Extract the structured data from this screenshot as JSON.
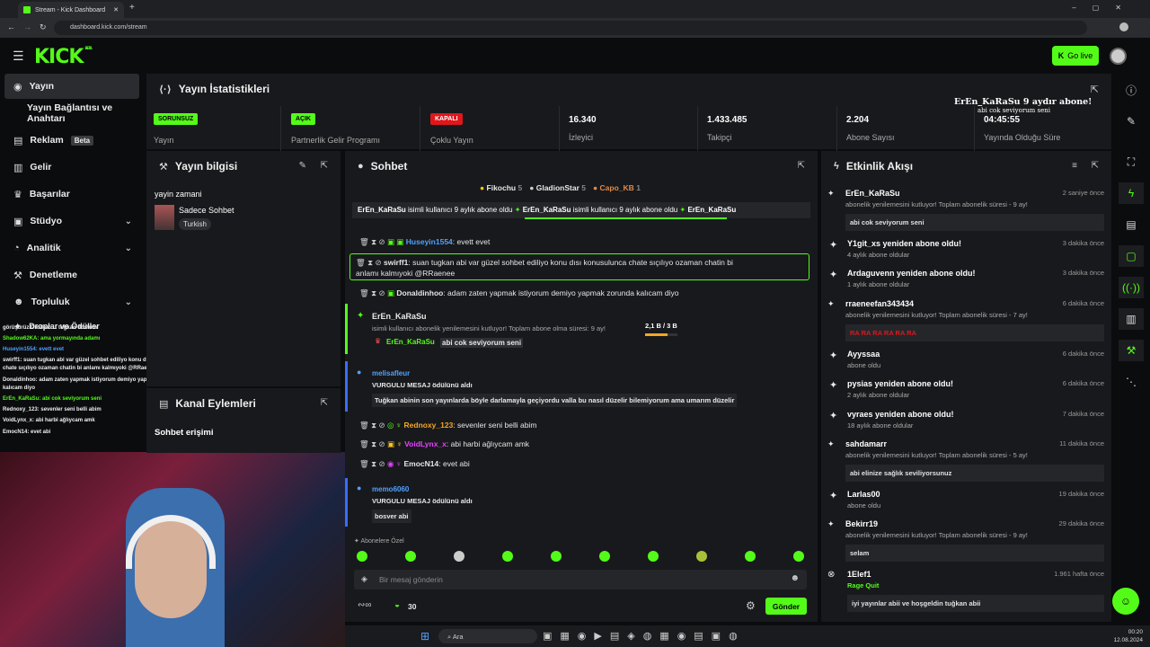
{
  "browser": {
    "tab_title": "Stream - Kick Dashboard",
    "url": "dashboard.kick.com/stream"
  },
  "header": {
    "logo": "KICK",
    "logo_sup": "BETA",
    "go_live": "Go live"
  },
  "sidebar": {
    "items": [
      {
        "label": "Yayın",
        "icon": "broadcast-icon"
      },
      {
        "label": "Yayın Bağlantısı ve Anahtarı",
        "icon": "key-icon"
      },
      {
        "label": "Reklam",
        "badge": "Beta",
        "icon": "ad-icon"
      },
      {
        "label": "Gelir",
        "icon": "revenue-icon"
      },
      {
        "label": "Başarılar",
        "icon": "trophy-icon"
      },
      {
        "label": "Stüdyo",
        "icon": "studio-icon"
      },
      {
        "label": "Analitik",
        "icon": "chart-icon"
      },
      {
        "label": "Denetleme",
        "icon": "gavel-icon"
      },
      {
        "label": "Topluluk",
        "icon": "community-icon"
      },
      {
        "label": "Droplar ve Ödüller",
        "icon": "gift-icon"
      }
    ]
  },
  "stats": {
    "title": "Yayın İstatistikleri",
    "items": [
      {
        "pill": "SORUNSUZ",
        "pill_color": "#53fc18",
        "label": "Yayın"
      },
      {
        "pill": "AÇIK",
        "pill_color": "#53fc18",
        "label": "Partnerlik Gelir Programı"
      },
      {
        "pill": "KAPALI",
        "pill_color": "#e0161d",
        "label": "Çoklu Yayın"
      },
      {
        "value": "16.340",
        "label": "İzleyici"
      },
      {
        "value": "1.433.485",
        "label": "Takipçi"
      },
      {
        "value": "2.204",
        "label": "Abone Sayısı"
      },
      {
        "value": "04:45:55",
        "label": "Yayında Olduğu Süre"
      }
    ]
  },
  "stream_info": {
    "title": "Yayın bilgisi",
    "stream_title": "yayin zamani",
    "category": "Sadece Sohbet",
    "language": "Turkish"
  },
  "channel_actions": {
    "title": "Kanal Eylemleri",
    "item": "Sohbet erişimi"
  },
  "chat": {
    "title": "Sohbet",
    "gifters": [
      {
        "name": "Fikochu",
        "count": "5"
      },
      {
        "name": "GladionStar",
        "count": "5"
      },
      {
        "name": "Capo_KB",
        "count": "1"
      }
    ],
    "ticker_user": "ErEn_KaRaSu",
    "ticker_text": "isimli kullanıcı 9 aylık abone oldu",
    "messages": [
      {
        "user": "Huseyin1554",
        "color": "#4ea1ff",
        "text": ": evett evet"
      },
      {
        "user": "swirff1",
        "color": "#ffffff",
        "text": ": suan tugkan abi var güzel sohbet ediliyo konu dısı konusulunca chate sıçılıyo ozaman chatin bi",
        "text2": "anlamı kalmıyoki @RRaenee"
      },
      {
        "user": "Donaldinhoo",
        "color": "#ffffff",
        "text": ": adam zaten yapmak istiyorum demiyo yapmak zorunda kalıcam diyo"
      }
    ],
    "sub_event": {
      "user": "ErEn_KaRaSu",
      "text": "isimli kullanıcı abonelik yenilemesini kutluyor! Toplam abone olma süresi: 9 ay!",
      "progress": "2,1 B / 3 B",
      "progress_value": 0.7,
      "msg_user": "ErEn_KaRaSu",
      "msg": "abi cok seviyorum seni"
    },
    "reward1": {
      "user": "melisafleur",
      "text": "VURGULU MESAJ ödülünü aldı",
      "quote": "Tuğkan abinin son yayınlarda böyle darlamayla geçiyordu valla bu nasıl düzelir bilemiyorum ama umarım düzelir"
    },
    "messages2": [
      {
        "user": "Rednoxy_123",
        "color": "#f5a623",
        "text": ": sevenler seni belli abim"
      },
      {
        "user": "VoidLynx_x",
        "color": "#e542ff",
        "text": ": abi harbi ağlıycam amk"
      },
      {
        "user": "EmocN14",
        "color": "#ffffff",
        "text": ": evet abi"
      }
    ],
    "reward2": {
      "user": "memo6060",
      "text": "VURGULU MESAJ ödülünü aldı",
      "quote": "bosver abi"
    },
    "sub_only": "Abonelere Özel",
    "input_placeholder": "Bir mesaj gönderin",
    "points": "30",
    "send": "Gönder"
  },
  "activity": {
    "title": "Etkinlik Akışı",
    "events": [
      {
        "name": "ErEn_KaRaSu",
        "sub": "abonelik yenilemesini kutluyor! Toplam abonelik süresi - 9 ay!",
        "time": "2 saniye önce",
        "quote": "abi cok seviyorum seni"
      },
      {
        "name": "Y1git_xs yeniden abone oldu!",
        "sub": "4 aylık abone oldular",
        "time": "3 dakika önce"
      },
      {
        "name": "Ardaguvenn yeniden abone oldu!",
        "sub": "1 aylık abone oldular",
        "time": "3 dakika önce"
      },
      {
        "name": "rraeneefan343434",
        "sub": "abonelik yenilemesini kutluyor! Toplam abonelik süresi - 7 ay!",
        "time": "6 dakika önce",
        "quote": "RA RA RA RA RA RA"
      },
      {
        "name": "Ayyssaa",
        "sub": "abone oldu",
        "time": "6 dakika önce"
      },
      {
        "name": "pysias yeniden abone oldu!",
        "sub": "2 aylık abone oldular",
        "time": "6 dakika önce"
      },
      {
        "name": "vyraes yeniden abone oldu!",
        "sub": "18 aylık abone oldular",
        "time": "7 dakika önce"
      },
      {
        "name": "sahdamarr",
        "sub": "abonelik yenilemesini kutluyor! Toplam abonelik süresi - 5 ay!",
        "time": "11 dakika önce",
        "quote": "abi elinize sağlık seviliyorsunuz"
      },
      {
        "name": "Larlas00",
        "sub": "abone oldu",
        "time": "19 dakika önce"
      },
      {
        "name": "Bekirr19",
        "sub": "abonelik yenilemesini kutluyor! Toplam abonelik süresi - 9 ay!",
        "time": "29 dakika önce",
        "quote": "selam"
      },
      {
        "name": "1Elef1",
        "sub": "Rage Quit",
        "time": "1.961 hafta önce",
        "quote": "iyi yayınlar abii ve hoşgeldin tuğkan abii"
      }
    ]
  },
  "overlay": {
    "sub_alert": "ErEn_KaRaSu 9 aydır abone!",
    "sub_alert_msg": "abi cok seviyorum seni",
    "chat_lines": [
      "görüşürüz Drodes: ... tuğkan dostum",
      "Shadow62KA: ama yormayında adamı",
      "Huseyin1554: evett evet",
      "swirff1: suan tugkan abi var güzel sohbet ediliyo konu dısı konusulunca",
      "chate sıçılıyo ozaman chatin bi anlamı kalmıyoki @RRaenee",
      "Donaldinhoo: adam zaten yapmak istiyorum demiyo yapmak zorunda",
      "kalıcam diyo",
      "ErEn_KaRaSu: abi cok seviyorum seni",
      "Rednoxy_123: sevenler seni belli abim",
      "VoidLynx_x: abi harbi ağlıycam amk",
      "EmocN14: evet abi"
    ]
  },
  "taskbar": {
    "search": "Ara",
    "time": "00:20",
    "date": "12.08.2024"
  }
}
